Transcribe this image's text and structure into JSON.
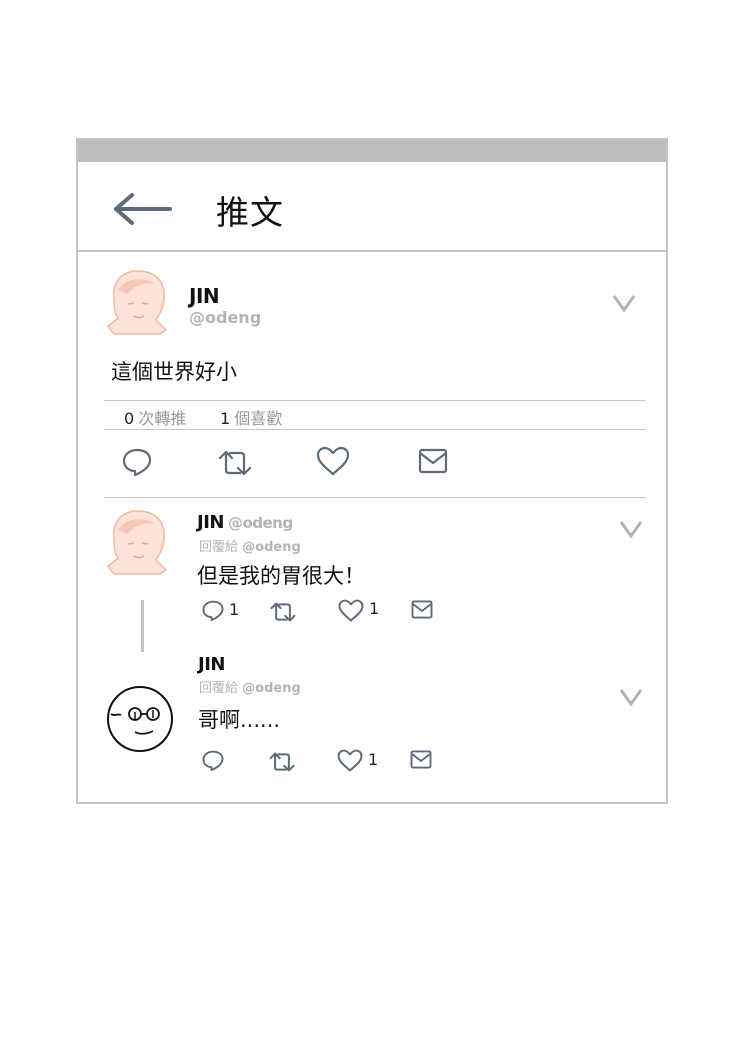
{
  "header": {
    "title": "推文"
  },
  "tweet": {
    "name": "JIN",
    "handle": "@odeng",
    "text": "這個世界好小",
    "retweet_count": "0",
    "retweet_label": "次轉推",
    "like_count": "1",
    "like_label": "個喜歡"
  },
  "replies": [
    {
      "name": "JIN",
      "handle": "@odeng",
      "reply_label": "回覆給",
      "reply_to": "@odeng",
      "text": "但是我的胃很大！",
      "reply_count": "1",
      "like_count": "1"
    },
    {
      "name": "JIN",
      "reply_label": "回覆給",
      "reply_to": "@odeng",
      "text": "哥啊......",
      "like_count": "1"
    }
  ],
  "colors": {
    "border": "#c4c4c4",
    "topbar": "#bdbdbd",
    "muted": "#b4b4b4",
    "avatar_tint": "#f6c8b4"
  },
  "icons": [
    "back-arrow-icon",
    "chevron-down-icon",
    "reply-icon",
    "retweet-icon",
    "heart-icon",
    "mail-icon"
  ]
}
